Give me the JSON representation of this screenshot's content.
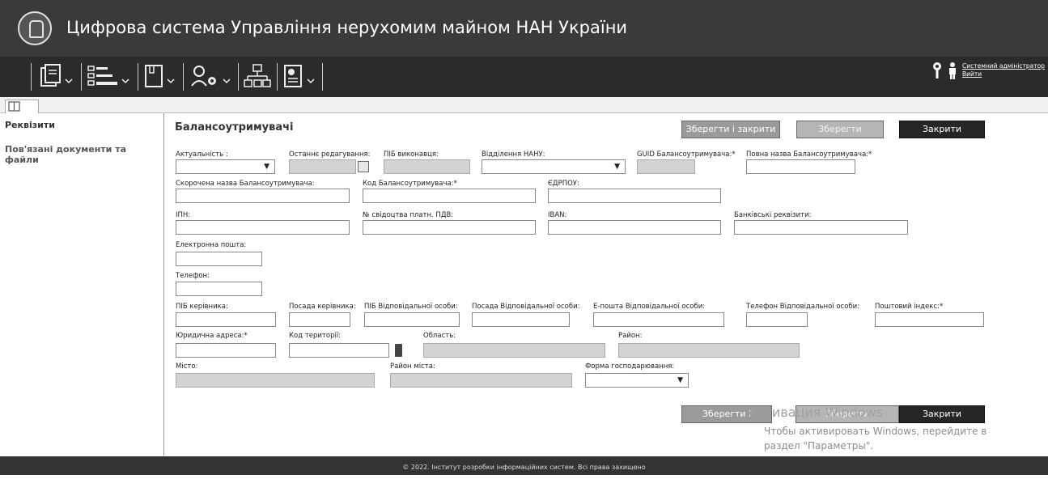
{
  "header": {
    "title": "Цифрова система Управління нерухомим майном НАН України"
  },
  "toolbar": {
    "icons": [
      "documents-icon",
      "list-icon",
      "book-icon",
      "users-settings-icon",
      "org-structure-icon",
      "report-icon"
    ]
  },
  "user": {
    "role_link": "Системний адміністратор",
    "logout_link": "Вийти"
  },
  "sidebar": {
    "items": [
      {
        "label": "Реквізити",
        "active": true
      },
      {
        "label": "Пов'язані документи та файли",
        "active": false
      }
    ]
  },
  "page": {
    "title": "Балансоутримувачі"
  },
  "buttons": {
    "save_close": "Зберегти і закрити",
    "save": "Зберегти",
    "close": "Закрити"
  },
  "form": {
    "labels": {
      "actuality": "Актуальність :",
      "last_edit": "Останнє редагування:",
      "executor": "ПІБ виконавця:",
      "department": "Відділення НАНУ:",
      "guid": "GUID Балансоутримувача:",
      "full_name": "Повна назва Балансоутримувача:",
      "short_name": "Скорочена назва Балансоутримувача:",
      "code": "Код Балансоутримувача:",
      "edrpou": "ЄДРПОУ:",
      "ipn": "ІПН:",
      "vat_cert": "№ свідоцтва платн. ПДВ:",
      "iban": "IBAN:",
      "bank": "Банківські реквізити:",
      "email": "Електронна пошта:",
      "phone": "Телефон:",
      "head_name": "ПІБ керівника:",
      "head_position": "Посада керівника:",
      "resp_name": "ПІБ Відповідальної особи:",
      "resp_position": "Посада Відповідальної особи:",
      "resp_email": "E-пошта Відповідальної особи:",
      "resp_phone": "Телефон Відповідальної особи:",
      "postal": "Поштовий індекс:",
      "legal_address": "Юридична адреса:",
      "territory_code": "Код території:",
      "region": "Область:",
      "district": "Район:",
      "city": "Місто:",
      "city_district": "Район міста:",
      "ownership": "Форма господарювання:"
    },
    "required_mark": "*"
  },
  "watermark": {
    "line1": "Активация Windows",
    "line2": "Чтобы активировать Windows, перейдите в",
    "line3": "раздел \"Параметры\"."
  },
  "footer": {
    "text": "© 2022. Інститут розробки інформаційних систем. Всі права захищено"
  }
}
